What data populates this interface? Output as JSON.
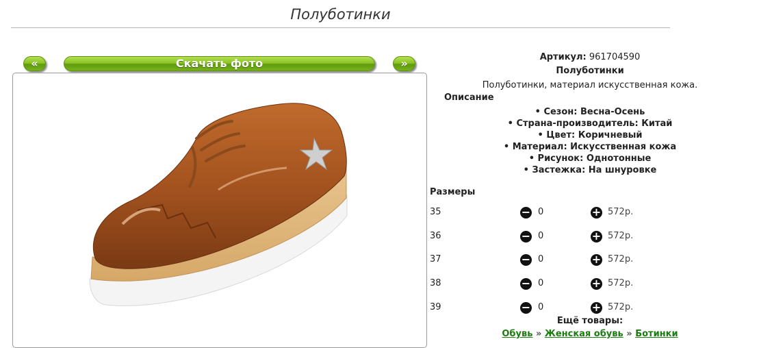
{
  "page": {
    "title": "Полуботинки"
  },
  "gallery": {
    "prev_label": "«",
    "download_label": "Скачать фото",
    "next_label": "»"
  },
  "product": {
    "article_label": "Артикул:",
    "article_value": "961704590",
    "name": "Полуботинки",
    "short_desc": "Полуботинки, материал искусственная кожа.",
    "description_heading": "Описание",
    "properties": [
      "Сезон: Весна-Осень",
      "Страна-производитель: Китай",
      "Цвет: Коричневый",
      "Материал: Искусственная кожа",
      "Рисунок: Однотонные",
      "Застежка: На шнуровке"
    ]
  },
  "sizes": {
    "heading": "Размеры",
    "rows": [
      {
        "size": "35",
        "qty": "0",
        "price": "572р."
      },
      {
        "size": "36",
        "qty": "0",
        "price": "572р."
      },
      {
        "size": "37",
        "qty": "0",
        "price": "572р."
      },
      {
        "size": "38",
        "qty": "0",
        "price": "572р."
      },
      {
        "size": "39",
        "qty": "0",
        "price": "572р."
      }
    ]
  },
  "more": {
    "label": "Ещё товары:",
    "breadcrumb": [
      "Обувь",
      "Женская обувь",
      "Ботинки"
    ],
    "separator": "»"
  },
  "colors": {
    "accent_green": "#8ac426",
    "link_green": "#1b7d10",
    "shoe_brown": "#a4531f"
  },
  "icons": {
    "minus": "minus-circle-icon",
    "plus": "plus-circle-icon"
  }
}
